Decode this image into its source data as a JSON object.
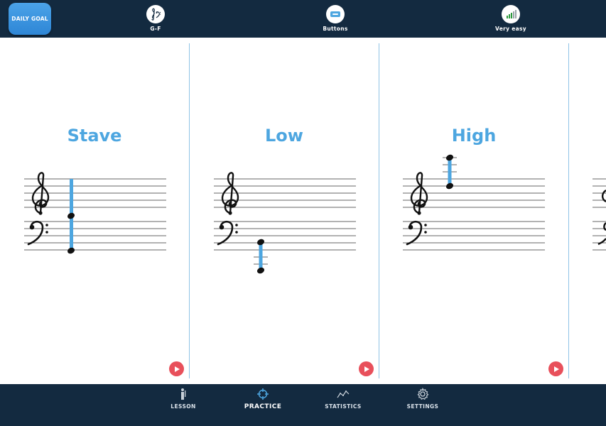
{
  "topbar": {
    "daily_goal": "DAILY GOAL",
    "items": [
      {
        "label": "G-F",
        "icon": "clef-range-icon"
      },
      {
        "label": "Buttons",
        "icon": "buttons-icon"
      },
      {
        "label": "Very easy",
        "icon": "difficulty-bars-icon"
      }
    ]
  },
  "cards": [
    {
      "title": "Stave",
      "icon": "play-icon"
    },
    {
      "title": "Low",
      "icon": "play-icon"
    },
    {
      "title": "High",
      "icon": "play-icon"
    }
  ],
  "bottom_nav": {
    "items": [
      {
        "label": "LESSON",
        "icon": "lesson-icon"
      },
      {
        "label": "PRACTICE",
        "icon": "target-icon",
        "active": true
      },
      {
        "label": "STATISTICS",
        "icon": "chart-line-icon"
      },
      {
        "label": "SETTINGS",
        "icon": "gear-icon"
      }
    ]
  },
  "colors": {
    "bar_background": "#132a40",
    "accent": "#4da6e0",
    "play": "#e8505b"
  }
}
